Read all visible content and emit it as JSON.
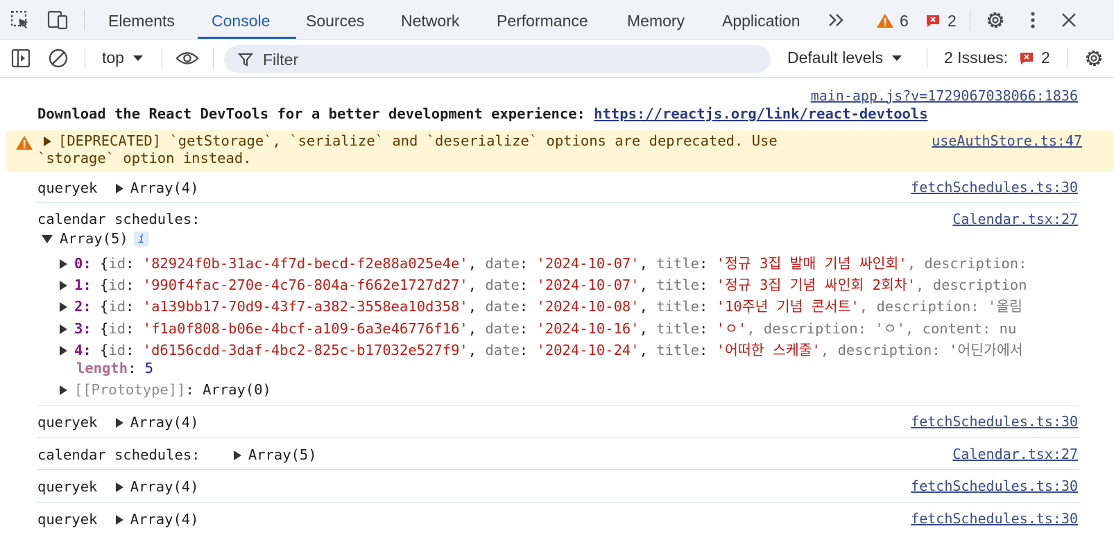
{
  "tabs": {
    "items": [
      "Elements",
      "Console",
      "Sources",
      "Network",
      "Performance",
      "Memory",
      "Application"
    ],
    "active": "Console",
    "more": "»",
    "warning_count": "6",
    "error_count": "2"
  },
  "toolbar": {
    "context": "top",
    "filter_placeholder": "Filter",
    "levels": "Default levels",
    "issues_label": "2 Issues:",
    "issues_count": "2"
  },
  "console": {
    "react_msg": {
      "source": "main-app.js?v=1729067038066:1836",
      "text": "Download the React DevTools for a better development experience: ",
      "link": "https://reactjs.org/link/react-devtools"
    },
    "warning": {
      "line1": "[DEPRECATED] `getStorage`, `serialize` and `deserialize` options are deprecated. Use",
      "line2": "`storage` option instead.",
      "source": "useAuthStore.ts:47"
    },
    "log1": {
      "label": "queryek",
      "value": "Array(4)",
      "source": "fetchSchedules.ts:30"
    },
    "expanded": {
      "label": "calendar schedules:",
      "array": "Array(5)",
      "source": "Calendar.tsx:27",
      "items": [
        {
          "idx": "0:",
          "id": "'82924f0b-31ac-4f7d-becd-f2e88a025e4e'",
          "date": "'2024-10-07'",
          "title": "'정규 3집 발매 기념 싸인회'",
          "rest": ", description: "
        },
        {
          "idx": "1:",
          "id": "'990f4fac-270e-4c76-804a-f662e1727d27'",
          "date": "'2024-10-07'",
          "title": "'정규 3집 기념 싸인회 2회차'",
          "rest": ", description"
        },
        {
          "idx": "2:",
          "id": "'a139bb17-70d9-43f7-a382-3558ea10d358'",
          "date": "'2024-10-08'",
          "title": "'10주년 기념 콘서트'",
          "rest": ", description: '올림"
        },
        {
          "idx": "3:",
          "id": "'f1a0f808-b06e-4bcf-a109-6a3e46776f16'",
          "date": "'2024-10-16'",
          "title": "'ㅇ'",
          "rest": ", description: 'ㅇ', content: nu"
        },
        {
          "idx": "4:",
          "id": "'d6156cdd-3daf-4bc2-825c-b17032e527f9'",
          "date": "'2024-10-24'",
          "title": "'어떠한 스케줄'",
          "rest": ", description: '어딘가에서"
        }
      ],
      "length_label": "length",
      "length_value": "5",
      "prototype_label": "[[Prototype]]",
      "prototype_value": ": Array(0)"
    },
    "log2": {
      "label": "queryek",
      "value": "Array(4)",
      "source": "fetchSchedules.ts:30"
    },
    "log3": {
      "label": "calendar schedules:",
      "value": "Array(5)",
      "source": "Calendar.tsx:27"
    },
    "log4": {
      "label": "queryek",
      "value": "Array(4)",
      "source": "fetchSchedules.ts:30"
    },
    "log5": {
      "label": "queryek",
      "value": "Array(4)",
      "source": "fetchSchedules.ts:30"
    }
  },
  "colors": {
    "accent": "#1a5fc7",
    "warning_bg": "#fef6d5",
    "string": "#c41a16",
    "index": "#881280"
  },
  "icons": [
    "inspect-element-icon",
    "device-toolbar-icon",
    "warning-icon",
    "error-icon",
    "settings-icon",
    "kebab-menu-icon",
    "close-icon",
    "sidebar-toggle-icon",
    "clear-console-icon",
    "eye-icon",
    "filter-icon",
    "chevron-down-icon"
  ]
}
